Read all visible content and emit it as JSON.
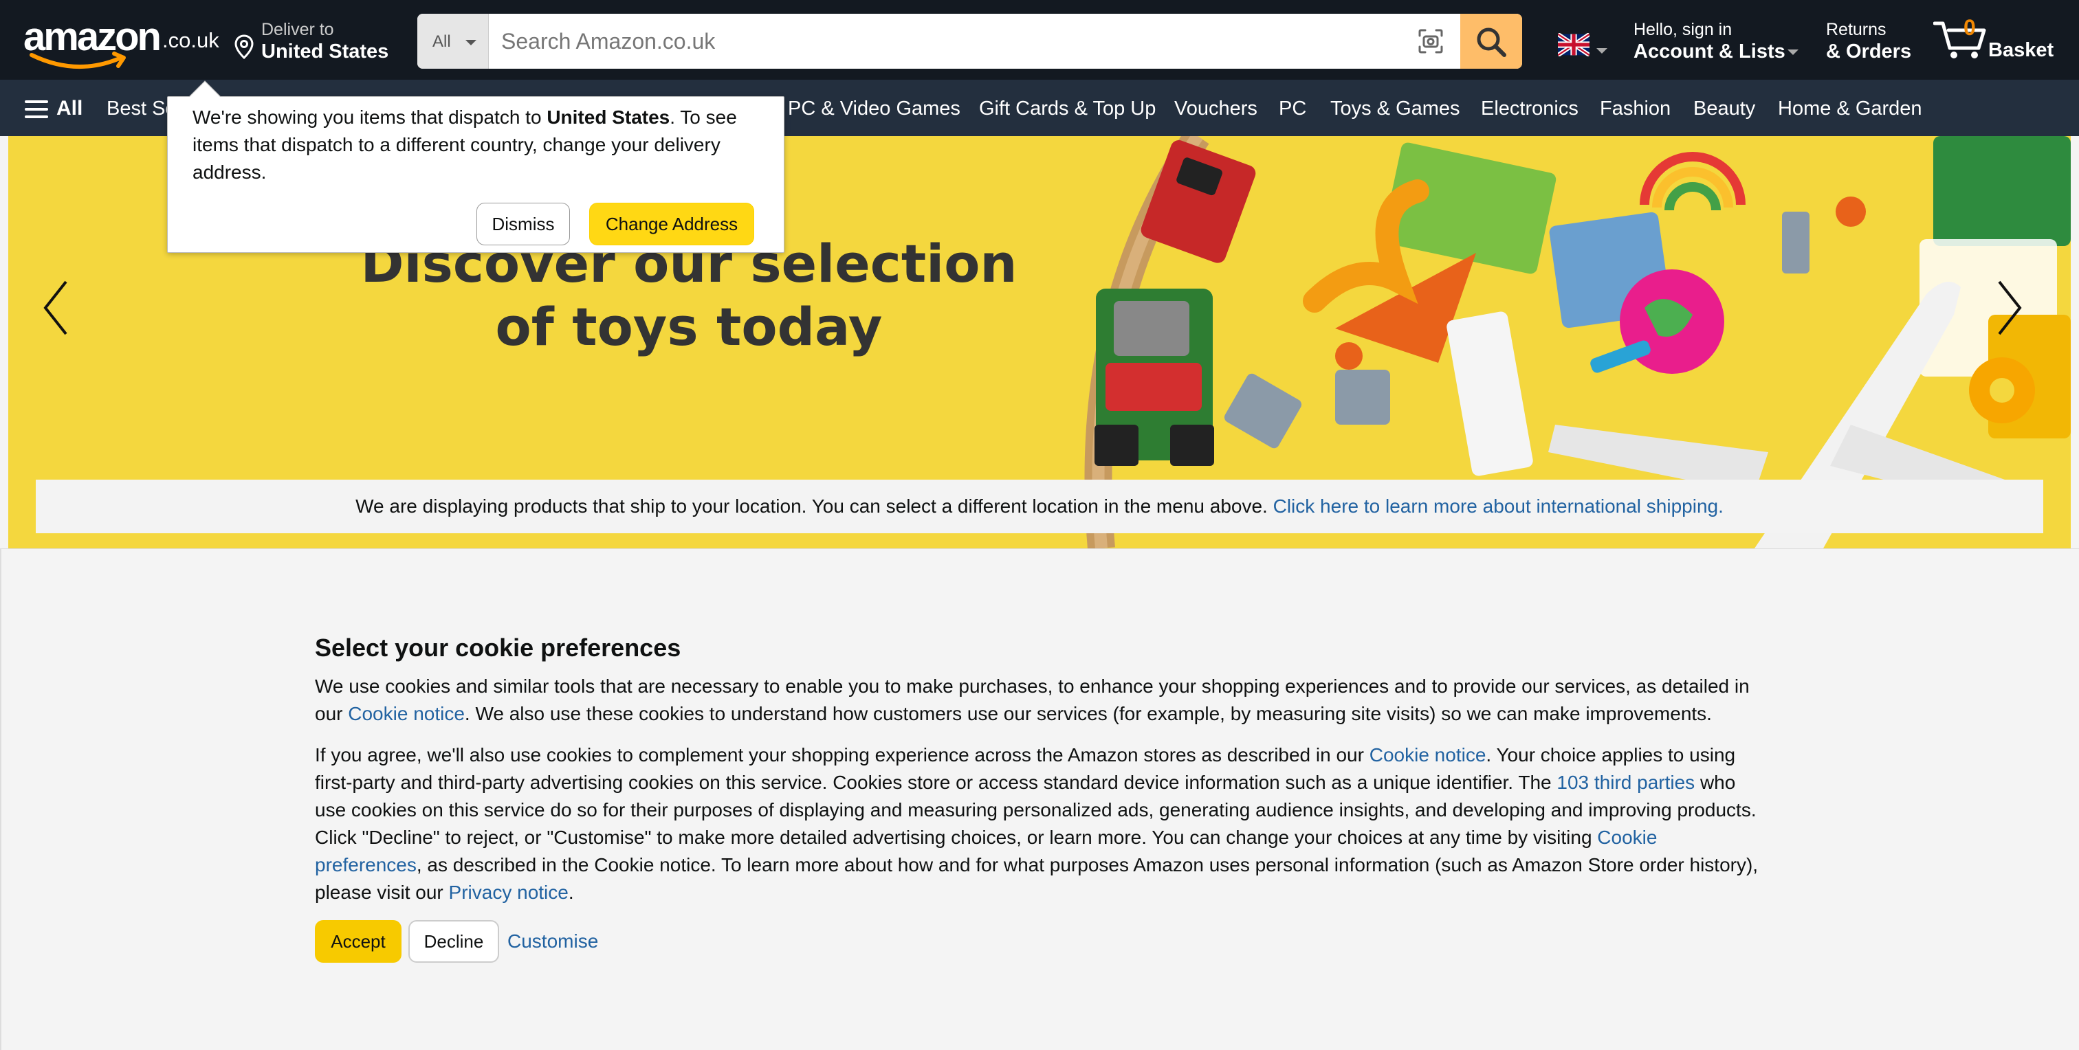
{
  "header": {
    "logo_text": "amazon",
    "logo_tld": ".co.uk",
    "deliver_line1": "Deliver to",
    "deliver_line2": "United States",
    "search": {
      "category": "All",
      "placeholder": "Search Amazon.co.uk"
    },
    "account_line1": "Hello, sign in",
    "account_line2": "Account & Lists",
    "returns_line1": "Returns",
    "returns_line2": "& Orders",
    "basket_count": "0",
    "basket_label": "Basket"
  },
  "nav": {
    "all_label": "All",
    "items": [
      "Best Se",
      "PC & Video Games",
      "Gift Cards & Top Up",
      "Vouchers",
      "PC",
      "Toys & Games",
      "Electronics",
      "Fashion",
      "Beauty",
      "Home & Garden"
    ]
  },
  "hero": {
    "title_line1": "Discover our selection",
    "title_line2": "of toys today"
  },
  "ship_banner": {
    "text": "We are displaying products that ship to your location. You can select a different location in the menu above. ",
    "link": "Click here to learn more about international shipping."
  },
  "popover": {
    "text_before": "We're showing you items that dispatch to ",
    "country": "United States",
    "text_after": ". To see items that dispatch to a different country, change your delivery address.",
    "dismiss_label": "Dismiss",
    "change_label": "Change Address"
  },
  "cookie": {
    "title": "Select your cookie preferences",
    "p1_a": "We use cookies and similar tools that are necessary to enable you to make purchases, to enhance your shopping experiences and to provide our services, as detailed in our ",
    "p1_link": "Cookie notice",
    "p1_b": ". We also use these cookies to understand how customers use our services (for example, by measuring site visits) so we can make improvements.",
    "p2_a": "If you agree, we'll also use cookies to complement your shopping experience across the Amazon stores as described in our ",
    "p2_link1": "Cookie notice",
    "p2_b": ". Your choice applies to using first-party and third-party advertising cookies on this service. Cookies store or access standard device information such as a unique identifier. The ",
    "p2_link2": "103 third parties",
    "p2_c": " who use cookies on this service do so for their purposes of displaying and measuring personalized ads, generating audience insights, and developing and improving products. Click \"Decline\" to reject, or \"Customise\" to make more detailed advertising choices, or learn more. You can change your choices at any time by visiting ",
    "p2_link3": "Cookie preferences",
    "p2_d": ", as described in the Cookie notice. To learn more about how and for what purposes Amazon uses personal information (such as Amazon Store order history), please visit our ",
    "p2_link4": "Privacy notice",
    "p2_e": ".",
    "accept_label": "Accept",
    "decline_label": "Decline",
    "customise_label": "Customise"
  },
  "colors": {
    "header_bg": "#131921",
    "nav_bg": "#232f3e",
    "search_button": "#febd69",
    "accept_button": "#f7ca00",
    "change_address_button": "#ffd814",
    "link": "#2162a1",
    "hero_bg": "#f4d73e"
  },
  "icons": [
    "location-pin-icon",
    "camera-search-icon",
    "search-icon",
    "uk-flag-icon",
    "cart-icon",
    "hamburger-menu-icon",
    "chevron-left-icon",
    "chevron-right-icon"
  ]
}
